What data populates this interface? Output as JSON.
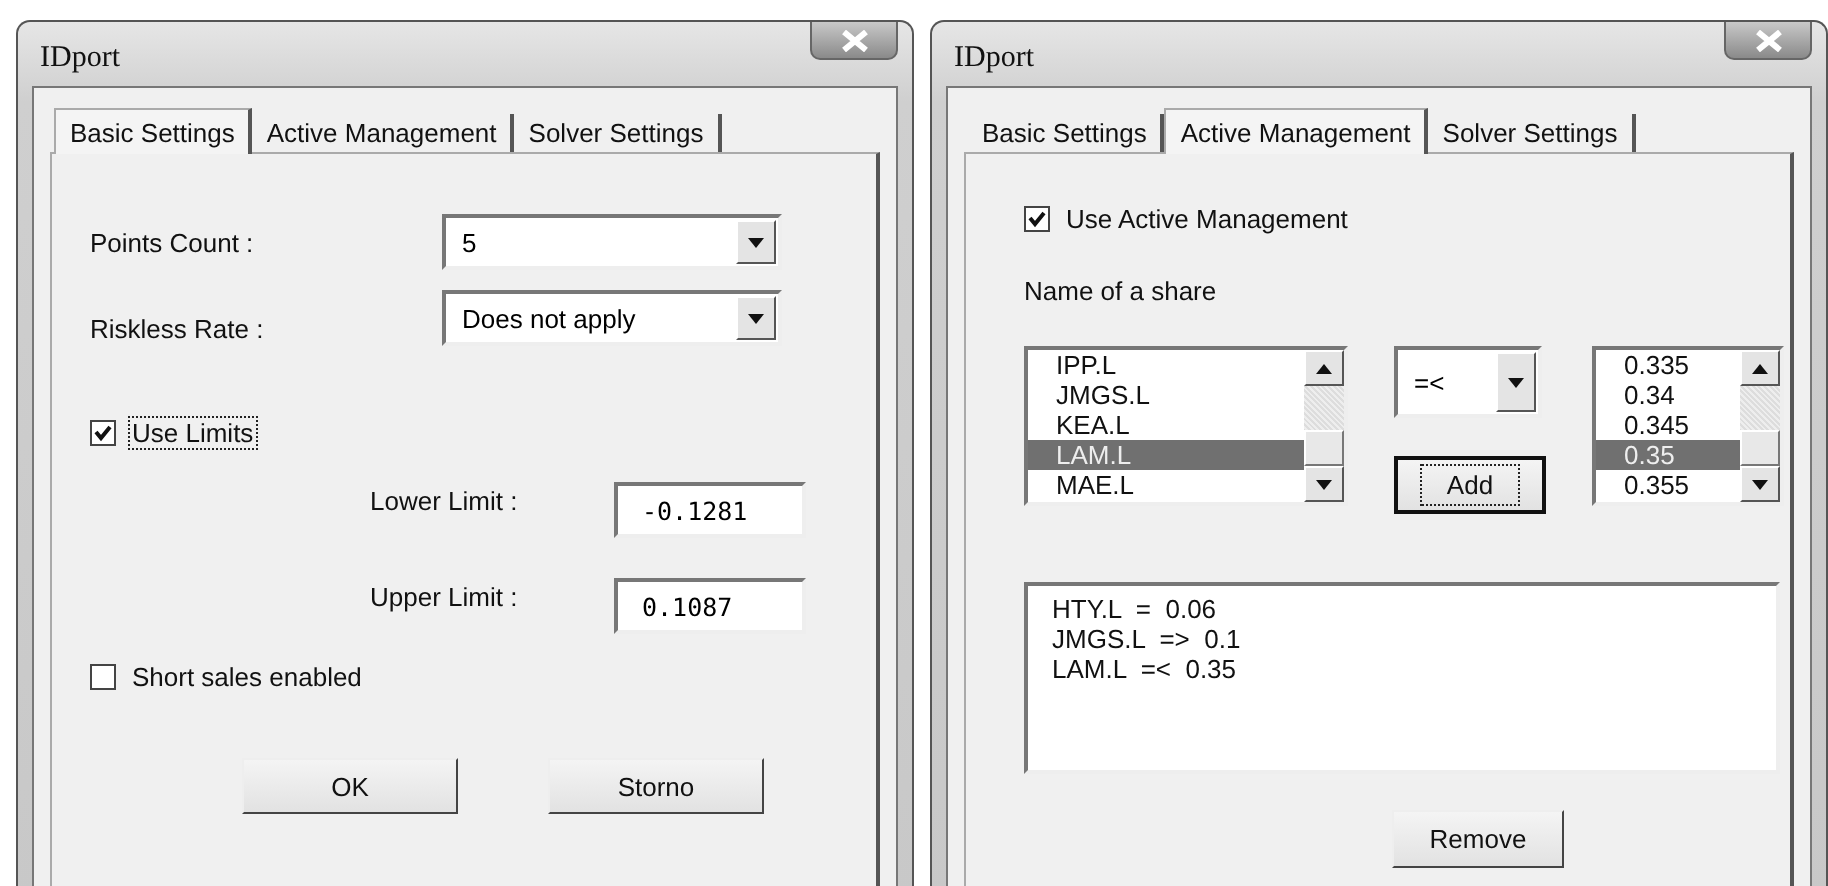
{
  "windows": [
    {
      "title": "IDport",
      "tabs": [
        {
          "label": "Basic Settings",
          "selected": true
        },
        {
          "label": "Active Management",
          "selected": false
        },
        {
          "label": "Solver Settings",
          "selected": false
        }
      ],
      "content": {
        "kind": "basic",
        "points_count": {
          "label": "Points Count :",
          "value": "5"
        },
        "riskless_rate": {
          "label": "Riskless Rate :",
          "value": "Does not apply"
        },
        "use_limits": {
          "label": "Use Limits",
          "checked": true,
          "focused": true
        },
        "lower_limit": {
          "label": "Lower Limit :",
          "value": "-0.1281"
        },
        "upper_limit": {
          "label": "Upper Limit :",
          "value": "0.1087"
        },
        "short_sales": {
          "label": "Short sales enabled",
          "checked": false,
          "focused": false
        },
        "buttons": [
          {
            "label": "OK",
            "focused": false
          },
          {
            "label": "Storno",
            "focused": false
          }
        ]
      }
    },
    {
      "title": "IDport",
      "tabs": [
        {
          "label": "Basic Settings",
          "selected": false
        },
        {
          "label": "Active Management",
          "selected": true
        },
        {
          "label": "Solver Settings",
          "selected": false
        }
      ],
      "content": {
        "kind": "active",
        "use_active": {
          "label": "Use Active Management",
          "checked": true,
          "focused": false
        },
        "share_label": "Name of a share",
        "shares": [
          {
            "label": "IPP.L",
            "selected": false
          },
          {
            "label": "JMGS.L",
            "selected": false
          },
          {
            "label": "KEA.L",
            "selected": false
          },
          {
            "label": "LAM.L",
            "selected": true
          },
          {
            "label": "MAE.L",
            "selected": false
          }
        ],
        "operator": {
          "value": "=<"
        },
        "add_button": {
          "label": "Add",
          "focused": true
        },
        "values": [
          {
            "label": "0.335",
            "selected": false
          },
          {
            "label": "0.34",
            "selected": false
          },
          {
            "label": "0.345",
            "selected": false
          },
          {
            "label": "0.35",
            "selected": true
          },
          {
            "label": "0.355",
            "selected": false
          }
        ],
        "constraints": [
          "HTY.L  =  0.06",
          "JMGS.L  =>  0.1",
          "LAM.L  =<  0.35"
        ],
        "remove_button": {
          "label": "Remove",
          "focused": false
        }
      }
    }
  ]
}
